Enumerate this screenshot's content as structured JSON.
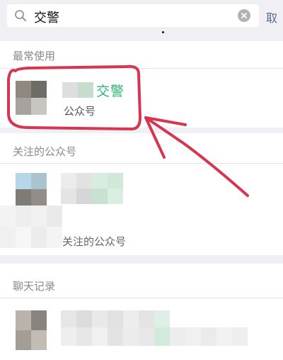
{
  "search": {
    "query": "交警",
    "cancel_label": "取"
  },
  "sections": {
    "frequent": {
      "title": "最常使用"
    },
    "followed": {
      "title": "关注的公众号"
    },
    "chats": {
      "title": "聊天记录"
    }
  },
  "frequent_item": {
    "name": "交警",
    "type": "公众号"
  },
  "followed_more_label": "关注的公众号",
  "colors": {
    "highlight_green": "#2bb673",
    "annotation_red": "#d6364f",
    "link_blue": "#576b95"
  }
}
